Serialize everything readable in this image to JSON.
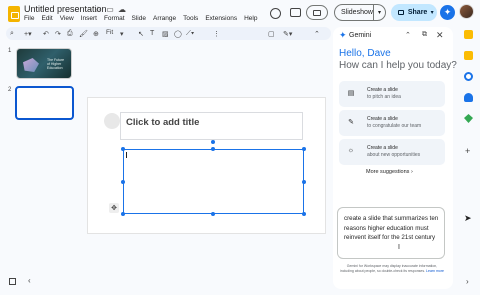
{
  "header": {
    "doc_title": "Untitled presentation",
    "menu": [
      "File",
      "Edit",
      "View",
      "Insert",
      "Format",
      "Slide",
      "Arrange",
      "Tools",
      "Extensions",
      "Help"
    ],
    "slideshow_label": "Slideshow",
    "share_label": "Share"
  },
  "toolbar": {
    "zoom_label": "Fit"
  },
  "slides": {
    "slide1_number": "1",
    "slide1_title": "The Future of Higher Education",
    "slide2_number": "2"
  },
  "canvas": {
    "title_placeholder": "Click to add title"
  },
  "gemini": {
    "label": "Gemini",
    "greeting": "Hello, Dave",
    "greeting_sub": "How can I help you today?",
    "suggestions": [
      {
        "line1": "Create a slide",
        "line2": "to pitch an idea",
        "icon": "slides-icon"
      },
      {
        "line1": "Create a slide",
        "line2": "to congratulate our team",
        "icon": "pen-icon"
      },
      {
        "line1": "Create a slide",
        "line2": "about new opportunities",
        "icon": "lightbulb-icon"
      }
    ],
    "more_suggestions": "More suggestions",
    "prompt_text": "create a slide that summarizes ten reasons higher education must reinvent itself for the 21st century",
    "disclaimer": "Gemini for Workspace may display inaccurate information, including about people, so double-check its responses.",
    "learn_more": "Learn more"
  },
  "colors": {
    "accent": "#0b57d0",
    "share_bg": "#c2e7ff",
    "gemini_blue": "#1a73e8",
    "selection": "#1a73e8"
  }
}
